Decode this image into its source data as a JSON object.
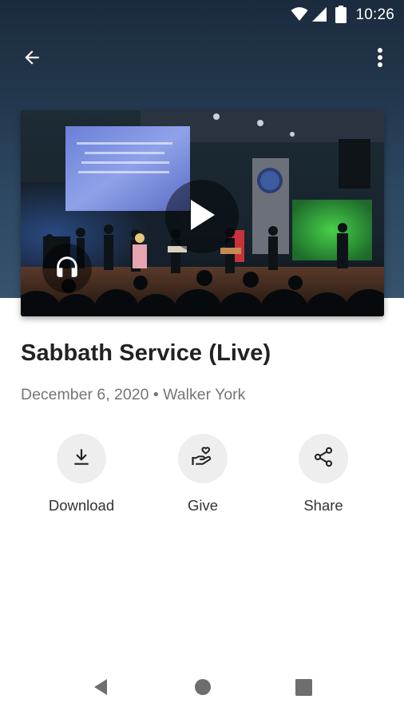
{
  "status_bar": {
    "time": "10:26",
    "icons": [
      "wifi-icon",
      "signal-icon",
      "battery-icon"
    ]
  },
  "app_bar": {
    "back_icon": "arrow-back-icon",
    "menu_icon": "more-vert-icon"
  },
  "media": {
    "play_icon": "play-icon",
    "audio_icon": "headphones-icon"
  },
  "sermon": {
    "title": "Sabbath Service (Live)",
    "date": "December 6, 2020",
    "separator": "•",
    "speaker": "Walker York"
  },
  "actions": [
    {
      "label": "Download",
      "icon": "download-icon"
    },
    {
      "label": "Give",
      "icon": "give-hand-heart-icon"
    },
    {
      "label": "Share",
      "icon": "share-icon"
    }
  ],
  "nav_bar": {
    "icons": [
      "nav-back-icon",
      "nav-home-icon",
      "nav-recents-icon"
    ]
  },
  "colors": {
    "header_top": "#1b2b3e",
    "header_bottom": "#37526d",
    "title": "#222222",
    "subtitle": "#757575",
    "action_circle": "#eeeeee"
  }
}
